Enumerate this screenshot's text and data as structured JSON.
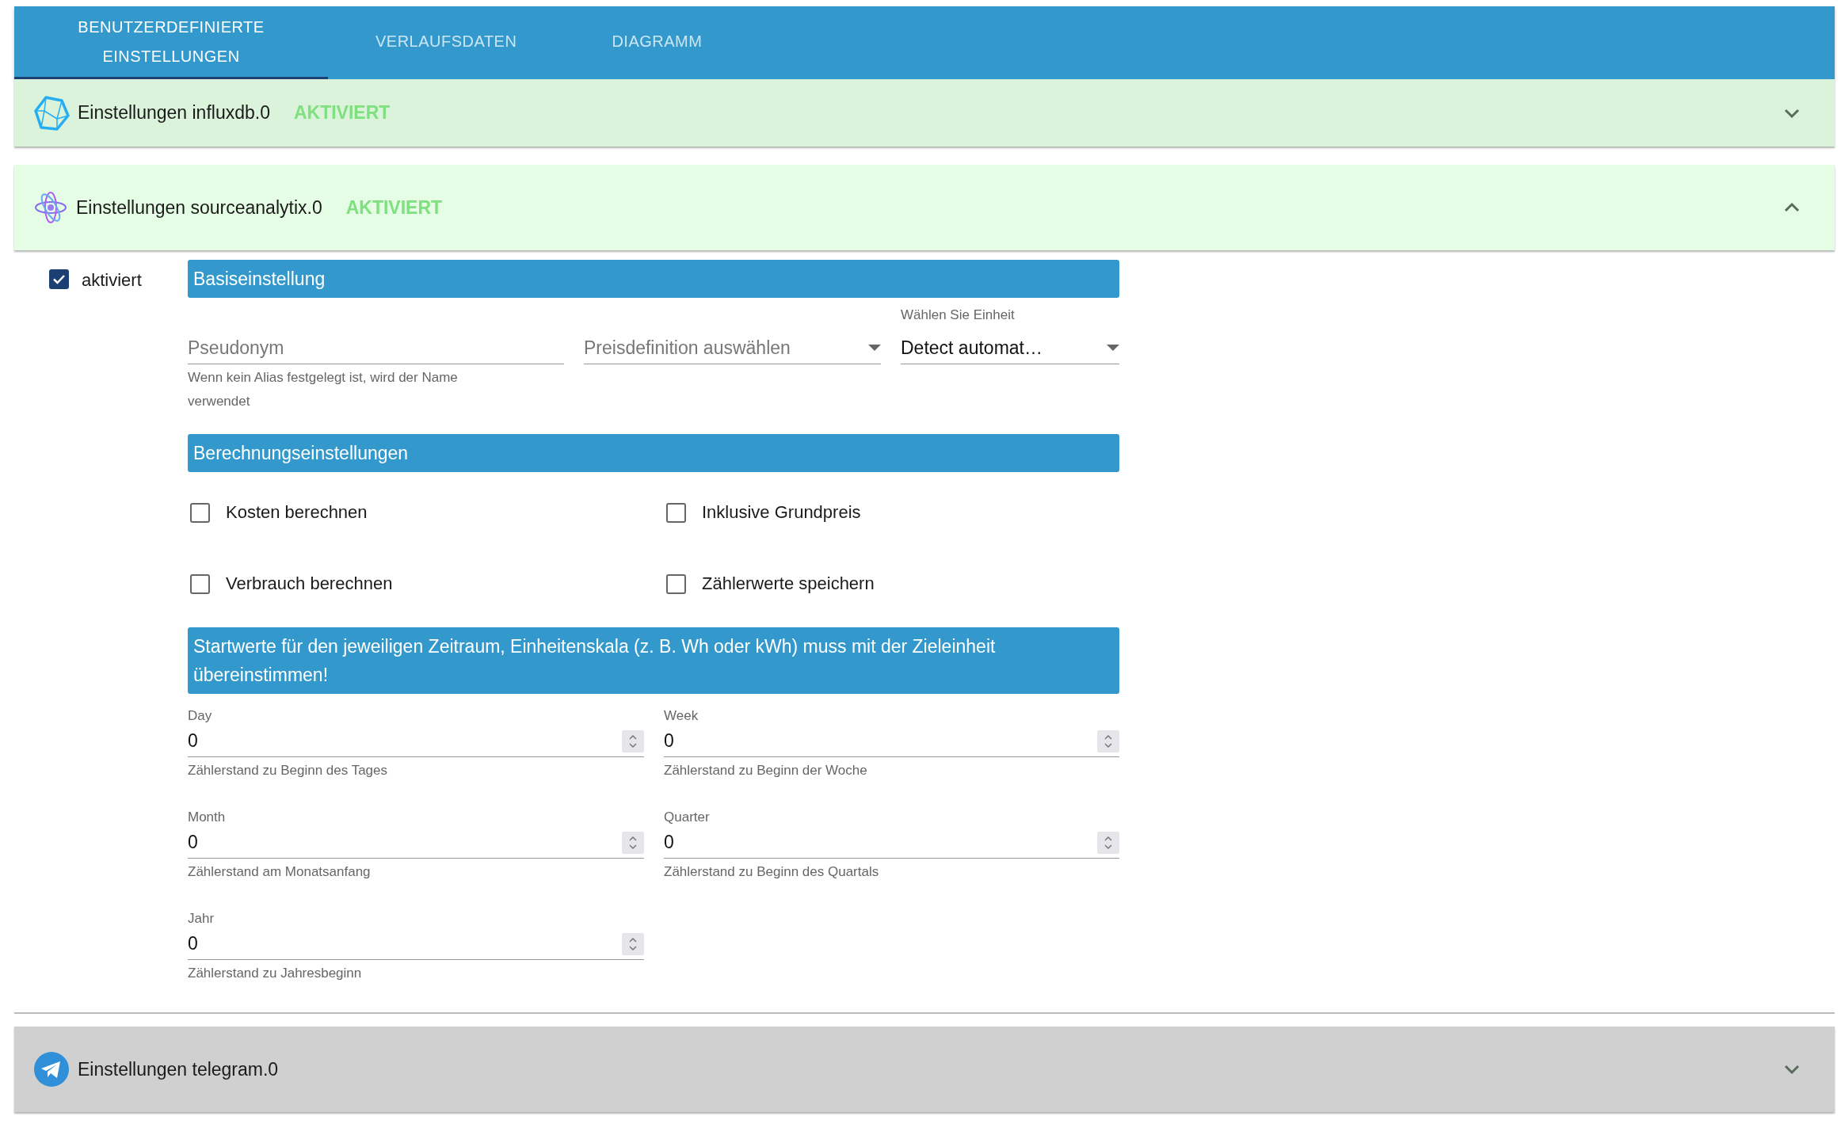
{
  "tabs": [
    {
      "label": "BENUTZERDEFINIERTE EINSTELLUNGEN",
      "selected": true
    },
    {
      "label": "VERLAUFSDATEN",
      "selected": false
    },
    {
      "label": "DIAGRAMM",
      "selected": false
    }
  ],
  "panels": [
    {
      "kind": "influx",
      "title": "Einstellungen influxdb.0",
      "status": "AKTIVIERT",
      "expanded": false
    },
    {
      "kind": "atom",
      "title": "Einstellungen sourceanalytix.0",
      "status": "AKTIVIERT",
      "expanded": true,
      "content": {
        "enabled": {
          "label": "aktiviert",
          "checked": true
        },
        "basic_heading": "Basiseinstellung",
        "alias": {
          "placeholder": "Pseudonym",
          "helper": "Wenn kein Alias festgelegt ist, wird der Name verwendet"
        },
        "price": {
          "placeholder": "Preisdefinition auswählen"
        },
        "unit": {
          "label": "Wählen Sie Einheit",
          "value": "Detect automat…"
        },
        "calc_heading": "Berechnungseinstellungen",
        "options": [
          {
            "label": "Kosten berechnen",
            "checked": false
          },
          {
            "label": "Inklusive Grundpreis",
            "checked": false
          },
          {
            "label": "Verbrauch berechnen",
            "checked": false
          },
          {
            "label": "Zählerwerte speichern",
            "checked": false
          }
        ],
        "start_heading": "Startwerte für den jeweiligen Zeitraum, Einheitenskala (z. B. Wh oder kWh) muss mit der Zieleinheit übereinstimmen!",
        "start_values": [
          {
            "label": "Day",
            "value": "0",
            "helper": "Zählerstand zu Beginn des Tages"
          },
          {
            "label": "Week",
            "value": "0",
            "helper": "Zählerstand zu Beginn der Woche"
          },
          {
            "label": "Month",
            "value": "0",
            "helper": "Zählerstand am Monatsanfang"
          },
          {
            "label": "Quarter",
            "value": "0",
            "helper": "Zählerstand zu Beginn des Quartals"
          },
          {
            "label": "Jahr",
            "value": "0",
            "helper": "Zählerstand zu Jahresbeginn"
          }
        ]
      }
    },
    {
      "kind": "telegram",
      "title": "Einstellungen telegram.0",
      "expanded": false
    }
  ]
}
